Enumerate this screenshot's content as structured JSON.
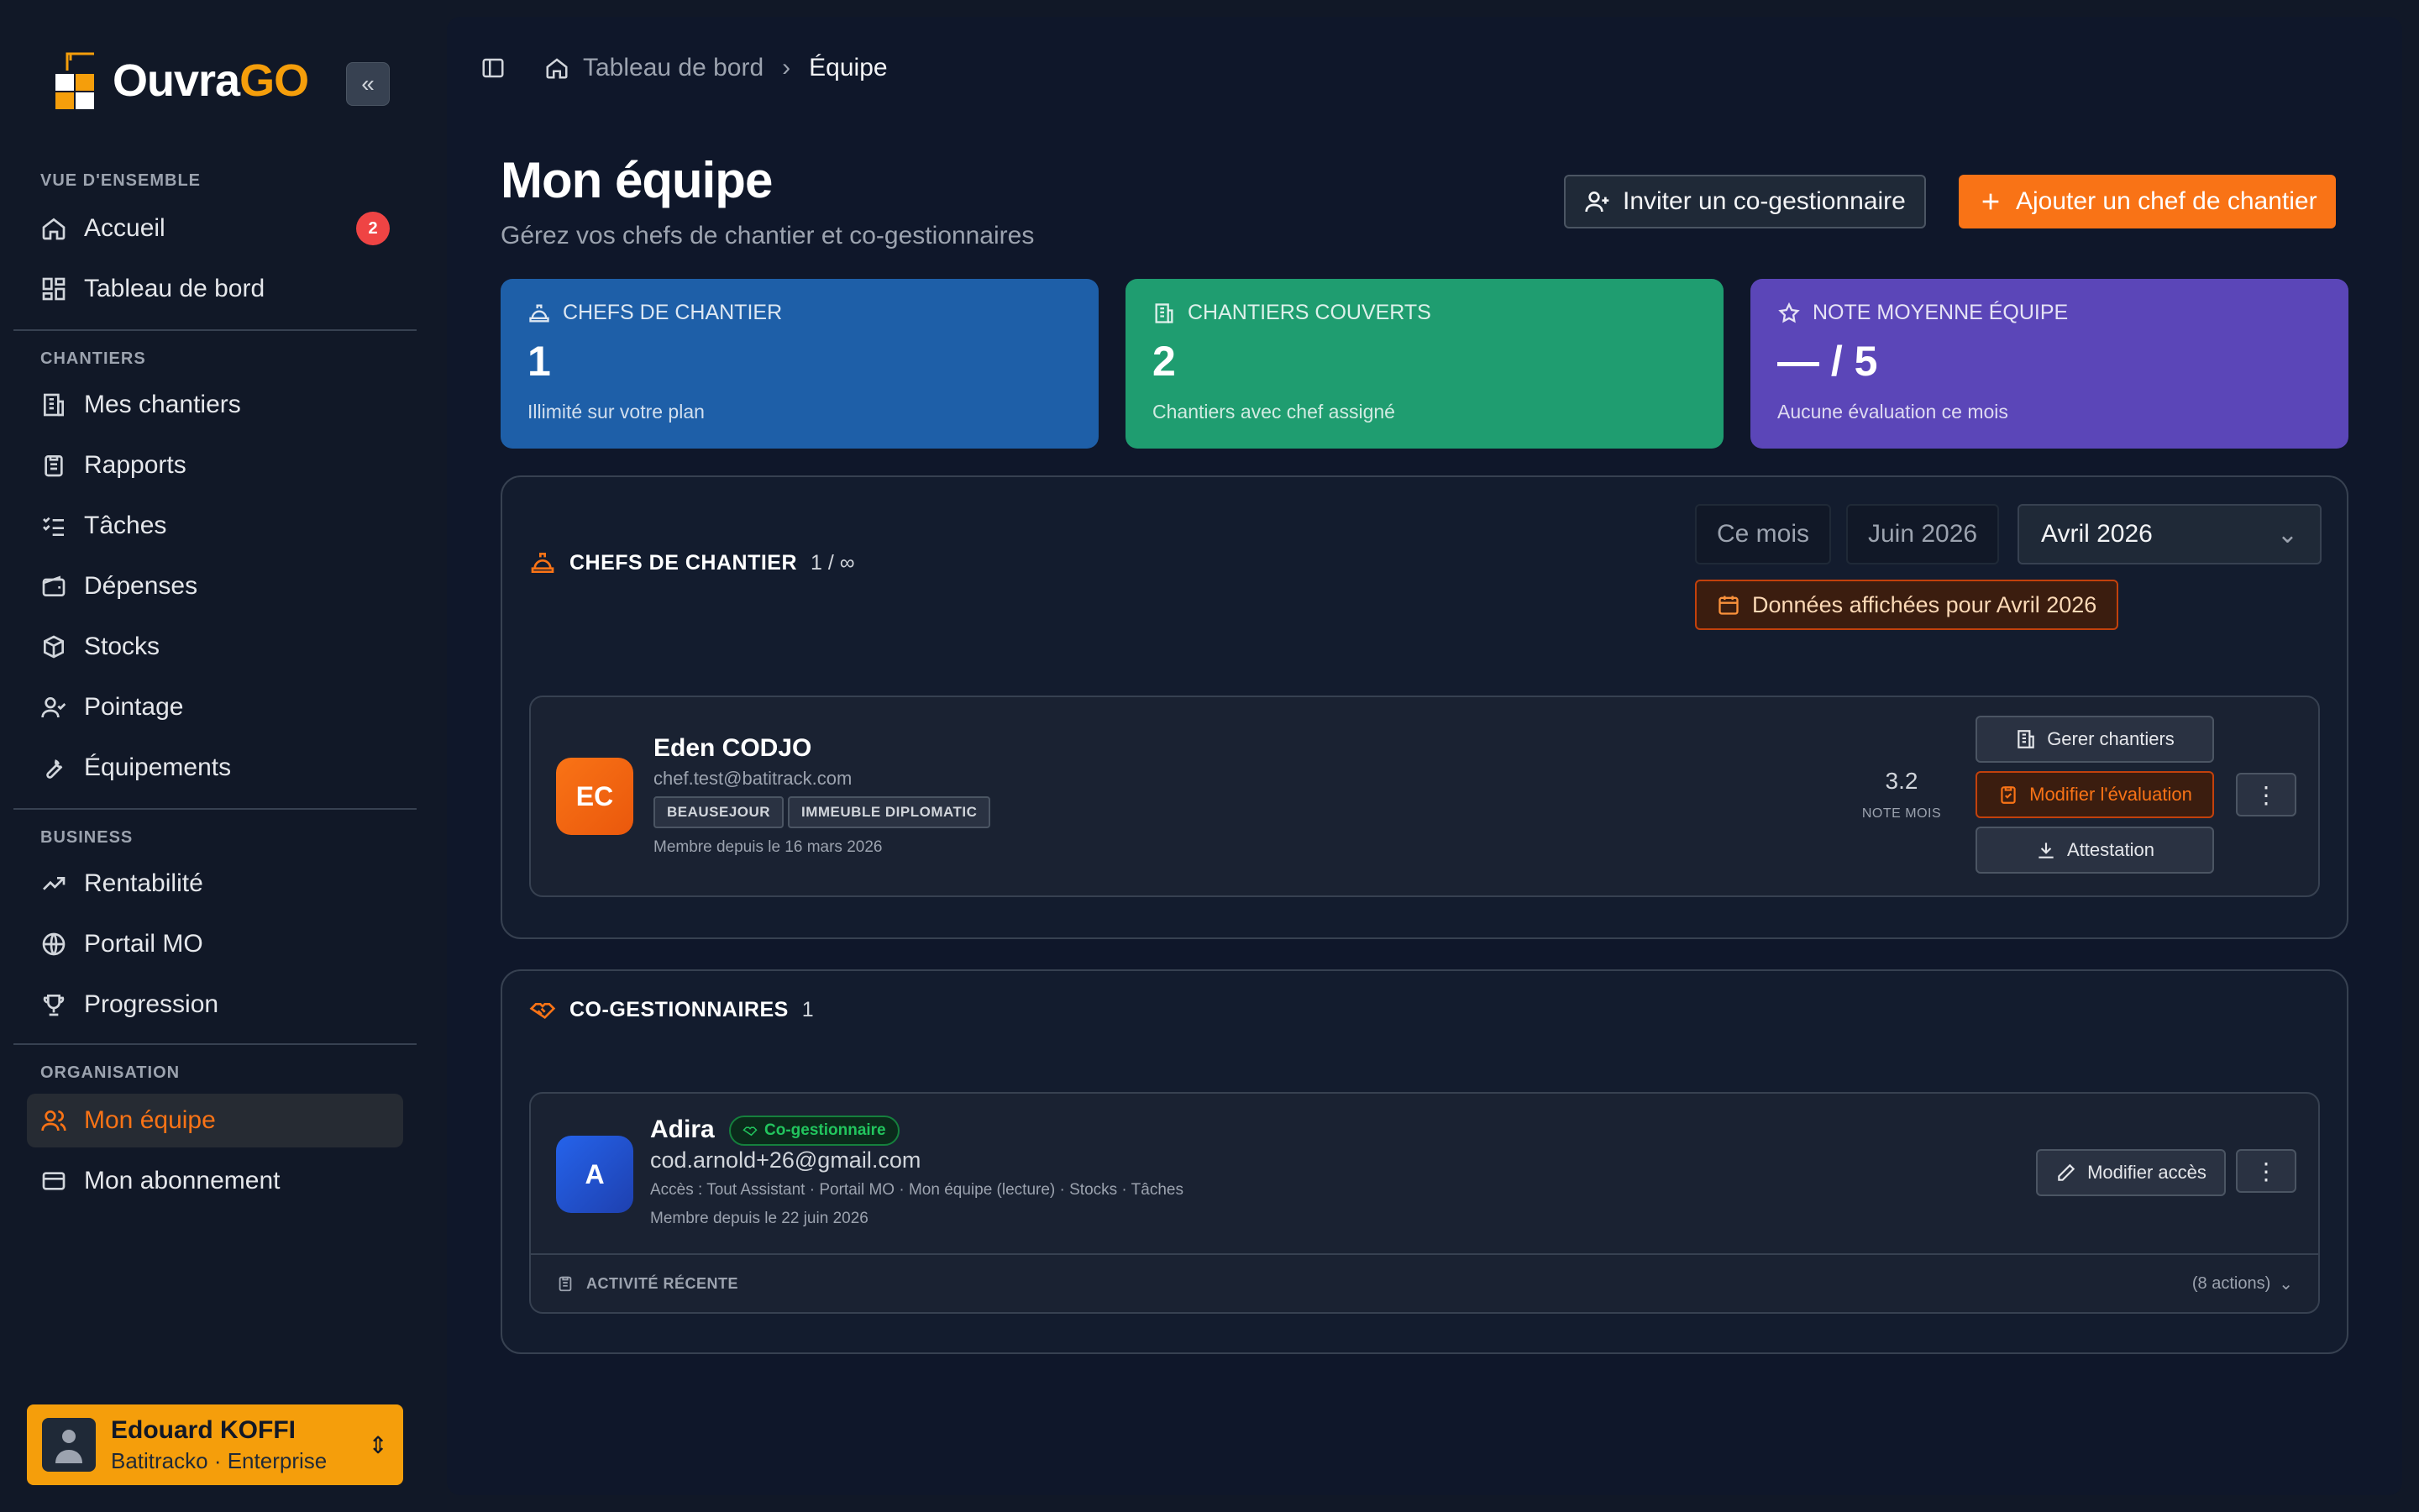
{
  "app": {
    "brand_a": "Ouvra",
    "brand_b": "GO"
  },
  "sidebar": {
    "sections": [
      {
        "title": "VUE D'ENSEMBLE"
      },
      {
        "title": "CHANTIERS"
      },
      {
        "title": "BUSINESS"
      },
      {
        "title": "ORGANISATION"
      }
    ],
    "items": [
      {
        "label": "Accueil",
        "icon": "home-icon",
        "badge": "2"
      },
      {
        "label": "Tableau de bord",
        "icon": "dashboard-icon"
      },
      {
        "label": "Mes chantiers",
        "icon": "building-icon"
      },
      {
        "label": "Rapports",
        "icon": "clipboard-icon"
      },
      {
        "label": "Tâches",
        "icon": "checklist-icon"
      },
      {
        "label": "Dépenses",
        "icon": "wallet-icon"
      },
      {
        "label": "Stocks",
        "icon": "package-icon"
      },
      {
        "label": "Pointage",
        "icon": "user-check-icon"
      },
      {
        "label": "Équipements",
        "icon": "wrench-icon"
      },
      {
        "label": "Rentabilité",
        "icon": "trending-up-icon"
      },
      {
        "label": "Portail MO",
        "icon": "globe-icon"
      },
      {
        "label": "Progression",
        "icon": "trophy-icon"
      },
      {
        "label": "Mon équipe",
        "icon": "users-icon",
        "active": true
      },
      {
        "label": "Mon abonnement",
        "icon": "credit-card-icon"
      }
    ],
    "user": {
      "name": "Edouard KOFFI",
      "subtitle": "Batitracko · Enterprise"
    }
  },
  "breadcrumb": {
    "home": "Tableau de bord",
    "current": "Équipe"
  },
  "header": {
    "title": "Mon équipe",
    "subtitle": "Gérez vos chefs de chantier et co-gestionnaires",
    "invite_label": "Inviter un co-gestionnaire",
    "add_label": "Ajouter un chef de chantier"
  },
  "stats": [
    {
      "label": "CHEFS DE CHANTIER",
      "value": "1",
      "note": "Illimité sur votre plan",
      "color": "#1e5fa8"
    },
    {
      "label": "CHANTIERS COUVERTS",
      "value": "2",
      "note": "Chantiers avec chef assigné",
      "color": "#1f9d70"
    },
    {
      "label": "NOTE MOYENNE ÉQUIPE",
      "value": "— / 5",
      "note": "Aucune évaluation ce mois",
      "color": "#5b46b8"
    }
  ],
  "chefs": {
    "title": "CHEFS DE CHANTIER",
    "count": "1 / ∞",
    "period_options": [
      "Ce mois",
      "Juin 2026"
    ],
    "period_selected": "Avril 2026",
    "period_note": "Données affichées pour Avril 2026",
    "members": [
      {
        "initials": "EC",
        "name": "Eden CODJO",
        "email": "chef.test@batitrack.com",
        "tags": [
          "BEAUSEJOUR",
          "IMMEUBLE DIPLOMATIC"
        ],
        "since": "Membre depuis le 16 mars 2026",
        "note_value": "3.2",
        "note_label": "NOTE MOIS",
        "btn_manage": "Gerer chantiers",
        "btn_eval": "Modifier l'évaluation",
        "btn_cert": "Attestation"
      }
    ]
  },
  "cogest": {
    "title": "CO-GESTIONNAIRES",
    "count": "1",
    "members": [
      {
        "initials": "A",
        "name": "Adira",
        "badge": "Co-gestionnaire",
        "email": "cod.arnold+26@gmail.com",
        "access": "Accès : Tout Assistant · Portail MO · Mon équipe (lecture) · Stocks · Tâches",
        "since": "Membre depuis le 22 juin 2026",
        "btn_access": "Modifier accès",
        "activity_label": "ACTIVITÉ RÉCENTE",
        "activity_count": "(8 actions)"
      }
    ]
  }
}
